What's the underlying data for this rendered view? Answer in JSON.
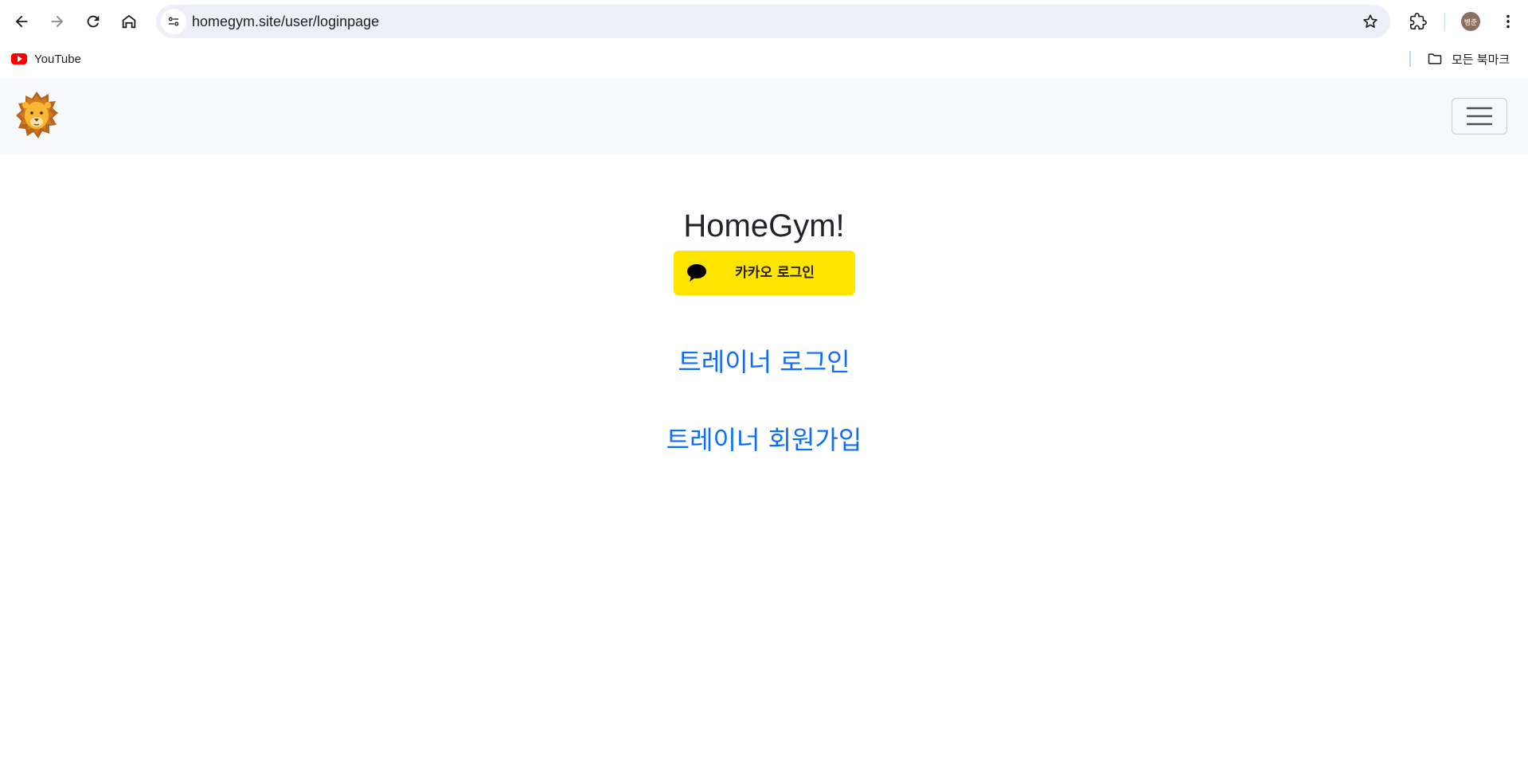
{
  "browser": {
    "url": "homegym.site/user/loginpage",
    "avatar_text": "병준",
    "icons": [
      "back-arrow-icon",
      "forward-arrow-icon",
      "reload-icon",
      "home-icon",
      "site-info-icon",
      "star-icon",
      "extensions-icon",
      "more-vert-icon"
    ]
  },
  "bookmarks": {
    "youtube_label": "YouTube",
    "all_bookmarks_label": "모든 북마크"
  },
  "navbar": {
    "logo": "lion-logo-icon",
    "toggler": "hamburger-menu-icon"
  },
  "main": {
    "title": "HomeGym!",
    "kakao_login_label": "카카오 로그인",
    "trainer_login_label": "트레이너 로그인",
    "trainer_signup_label": "트레이너 회원가입"
  },
  "colors": {
    "kakao_yellow": "#FEE500",
    "link_blue": "#0D6EFD",
    "navbar_bg": "#F8F9FA",
    "omnibox_bg": "#EDF0F8"
  }
}
